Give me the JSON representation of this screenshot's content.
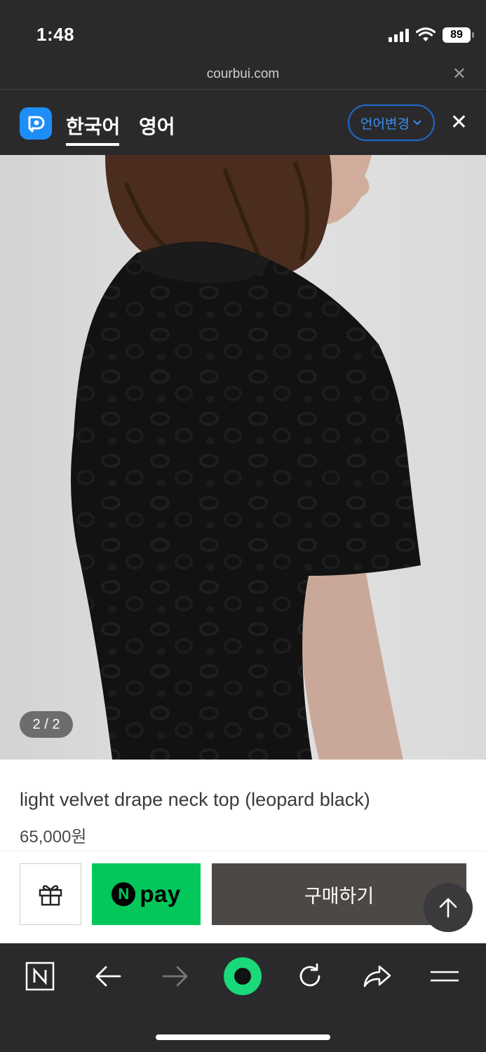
{
  "status_bar": {
    "time": "1:48",
    "battery": "89"
  },
  "url_bar": {
    "url": "courbui.com"
  },
  "translate_bar": {
    "tab_korean": "한국어",
    "tab_english": "영어",
    "change_language": "언어변경"
  },
  "gallery": {
    "page_indicator": "2 / 2"
  },
  "product": {
    "title": "light velvet drape neck top (leopard black)",
    "price": "65,000원"
  },
  "buy_bar": {
    "npay_letter": "N",
    "npay_label": "pay",
    "purchase_label": "구매하기"
  },
  "colors": {
    "chrome": "#2a2a2c",
    "papago_blue": "#1e8ef7",
    "npay_green": "#03c75a",
    "purchase_bg": "#4c4845"
  },
  "icons": [
    "wifi-icon",
    "signal-icon",
    "battery-icon",
    "close-icon",
    "papago-logo-icon",
    "chevron-down-icon",
    "gift-icon",
    "arrow-up-icon",
    "naver-n-icon",
    "back-icon",
    "forward-icon",
    "green-dot-icon",
    "refresh-icon",
    "share-icon",
    "menu-icon"
  ]
}
